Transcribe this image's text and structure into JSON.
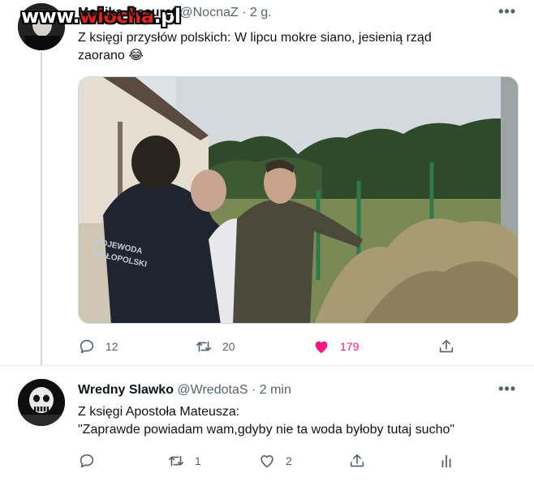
{
  "watermark": {
    "prefix": "www.",
    "brand": "wiocha",
    "suffix": ".pl"
  },
  "tweets": [
    {
      "author": {
        "name": "Monika Mesuret",
        "handle": "@NocnaZ",
        "time": "2 g."
      },
      "text_lines": [
        "Z księgi przysłów polskich: W lipcu mokre siano, jesienią rząd",
        "zaorano 😂"
      ],
      "actions": {
        "reply": "12",
        "retweet": "20",
        "like": "179"
      },
      "liked": true
    },
    {
      "author": {
        "name": "Wredny Slawko",
        "handle": "@WredotaS",
        "time": "2 min"
      },
      "text_lines": [
        "Z księgi Apostoła Mateusza:",
        "\"Zaprawde powiadam wam,gdyby nie ta woda byłoby tutaj sucho\""
      ],
      "actions": {
        "reply": "",
        "retweet": "1",
        "like": "2"
      },
      "liked": false
    }
  ],
  "dot": "·",
  "more_glyph": "•••",
  "colors": {
    "like_active": "#f91880",
    "secondary": "#536471"
  },
  "icons": [
    "reply-icon",
    "retweet-icon",
    "like-icon",
    "share-icon",
    "analytics-icon",
    "more-icon"
  ]
}
